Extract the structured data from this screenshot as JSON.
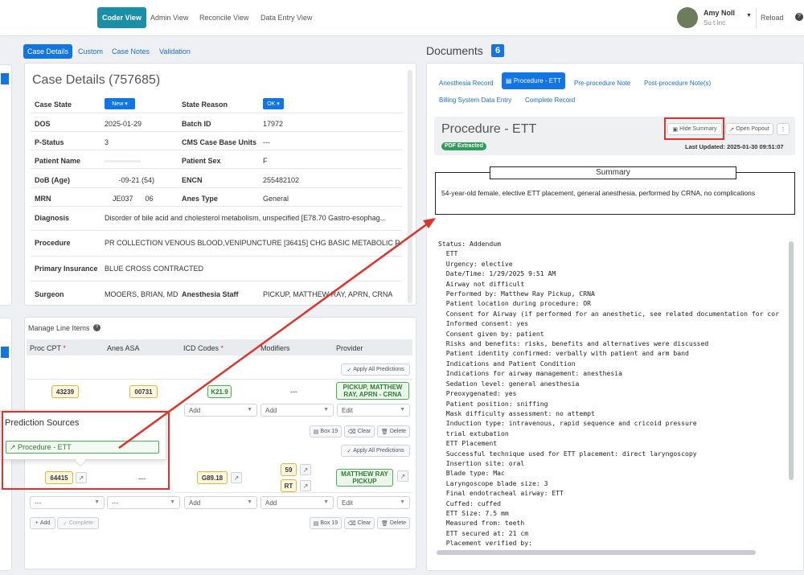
{
  "nav": {
    "items": [
      "Coder View",
      "Admin View",
      "Reconcile View",
      "Data Entry View"
    ],
    "user_name": "Amy Noll",
    "user_org": "Su      t Inc",
    "reload": "Reload"
  },
  "left_tabs": [
    "Case Details",
    "Custom",
    "Case Notes",
    "Validation"
  ],
  "case": {
    "title": "Case Details (757685)",
    "rows": [
      {
        "l1": "Case State",
        "v1": "New",
        "l2": "State Reason",
        "v2": "OK"
      },
      {
        "l1": "DOS",
        "v1": "2025-01-29",
        "l2": "Batch ID",
        "v2": "17972"
      },
      {
        "l1": "P-Status",
        "v1": "3",
        "l2": "CMS Case Base Units",
        "v2": "---"
      },
      {
        "l1": "Patient Name",
        "v1": "",
        "l2": "Patient Sex",
        "v2": "F"
      },
      {
        "l1": "DoB (Age)",
        "v1": "       -09-21 (54)",
        "l2": "ENCN",
        "v2": "255482102"
      },
      {
        "l1": "MRN",
        "v1": "    JE037      06",
        "l2": "Anes Type",
        "v2": "General"
      }
    ],
    "diagnosis_label": "Diagnosis",
    "diagnosis": "Disorder of bile acid and cholesterol metabolism, unspecified [E78.70 Gastro-esophag...",
    "procedure_label": "Procedure",
    "procedure": "PR COLLECTION VENOUS BLOOD,VENIPUNCTURE [36415] CHG BASIC METABOLIC P...",
    "insurance_label": "Primary Insurance",
    "insurance": "BLUE CROSS CONTRACTED",
    "surgeon_label": "Surgeon",
    "surgeon": "MOOERS, BRIAN, MD",
    "staff_label": "Anesthesia Staff",
    "staff": "PICKUP, MATTHEW RAY, APRN, CRNA"
  },
  "line_items": {
    "title": "Manage Line Items",
    "headers": [
      "Proc CPT",
      "Anes ASA",
      "ICD Codes",
      "Modifiers",
      "Provider"
    ],
    "apply_all": "Apply All Predictions",
    "row1": {
      "cpt": "43239",
      "asa": "00731",
      "icd": "K21.9",
      "mod": "---",
      "provider": "PICKUP, MATTHEW RAY, APRN - CRNA"
    },
    "row2": {
      "cpt": "64415",
      "asa": "---",
      "icd": "G89.18",
      "mods": [
        "59",
        "RT"
      ],
      "provider": "MATTHEW RAY PICKUP"
    },
    "add": "Add",
    "edit": "Edit",
    "dash": "---",
    "box": "Box 19",
    "clear": "Clear",
    "delete": "Delete",
    "add_btn": "Add",
    "complete_btn": "Complete"
  },
  "prediction": {
    "title": "Prediction Sources",
    "source": "Procedure - ETT"
  },
  "documents": {
    "title": "Documents",
    "count": "6",
    "tabs": [
      "Anesthesia Record",
      "Procedure - ETT",
      "Pre-procedure Note",
      "Post-procedure Note(s)",
      "Billing System Data Entry",
      "Complete Record"
    ],
    "doc_title": "Procedure - ETT",
    "badge": "PDF Extracted",
    "hide_summary": "Hide Summary",
    "open_popout": "Open Popout",
    "updated": "Last Updated: 2025-01-30 09:51:07",
    "summary_title": "Summary",
    "summary": "54-year-old female, elective ETT placement, general anesthesia, performed by CRNA, no complications",
    "text": "Status: Addendum\n  ETT\n  Urgency: elective\n  Date/Time: 1/29/2025 9:51 AM\n  Airway not difficult\n  Performed by: Matthew Ray Pickup, CRNA\n  Patient location during procedure: OR\n  Consent for Airway (if performed for an anesthetic, see related documentation for cor\n  Informed consent: yes\n  Consent given by: patient\n  Risks and benefits: risks, benefits and alternatives were discussed\n  Patient identity confirmed: verbally with patient and arm band\n  Indications and Patient Condition\n  Indications for airway management: anesthesia\n  Sedation level: general anesthesia\n  Preoxygenated: yes\n  Patient position: sniffing\n  Mask difficulty assessment: no attempt\n  Induction type: intravenous, rapid sequence and cricoid pressure\n  trial extubation\n  ETT Placement\n  Successful technique used for ETT placement: direct laryngoscopy\n  Insertion site: oral\n  Blade type: Mac\n  Laryngoscope blade size: 3\n  Final endotracheal airway: ETT\n  Cuffed: cuffed\n  ETT Size: 7.5 mm\n  Measured from: teeth\n  ETT secured at: 21 cm\n  Placement verified by:"
  }
}
